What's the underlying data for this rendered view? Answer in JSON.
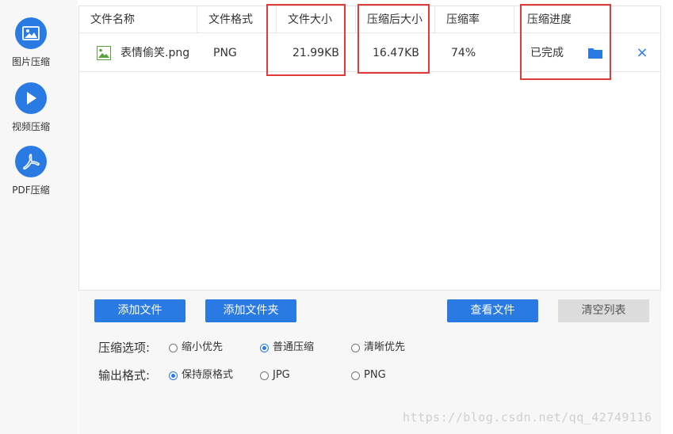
{
  "sidebar": {
    "items": [
      {
        "label": "图片压缩",
        "icon": "image-icon"
      },
      {
        "label": "视频压缩",
        "icon": "play-icon"
      },
      {
        "label": "PDF压缩",
        "icon": "pdf-icon"
      }
    ]
  },
  "table": {
    "columns": [
      "文件名称",
      "文件格式",
      "文件大小",
      "压缩后大小",
      "压缩率",
      "压缩进度"
    ],
    "rows": [
      {
        "name": "表情偷笑.png",
        "format": "PNG",
        "size": "21.99KB",
        "compressed_size": "16.47KB",
        "ratio": "74%",
        "status": "已完成",
        "close": "×"
      }
    ]
  },
  "buttons": {
    "add_file": "添加文件",
    "add_folder": "添加文件夹",
    "view_file": "查看文件",
    "clear_list": "清空列表"
  },
  "options": {
    "compress_label": "压缩选项:",
    "compress_options": [
      "缩小优先",
      "普通压缩",
      "清晰优先"
    ],
    "compress_selected": "普通压缩",
    "format_label": "输出格式:",
    "format_options": [
      "保持原格式",
      "JPG",
      "PNG"
    ],
    "format_selected": "保持原格式"
  },
  "watermark": "https://blog.csdn.net/qq_42749116",
  "colors": {
    "accent": "#2a7ae4",
    "highlight": "#e03a3a",
    "sidebar_bg": "#f7f7f7"
  }
}
